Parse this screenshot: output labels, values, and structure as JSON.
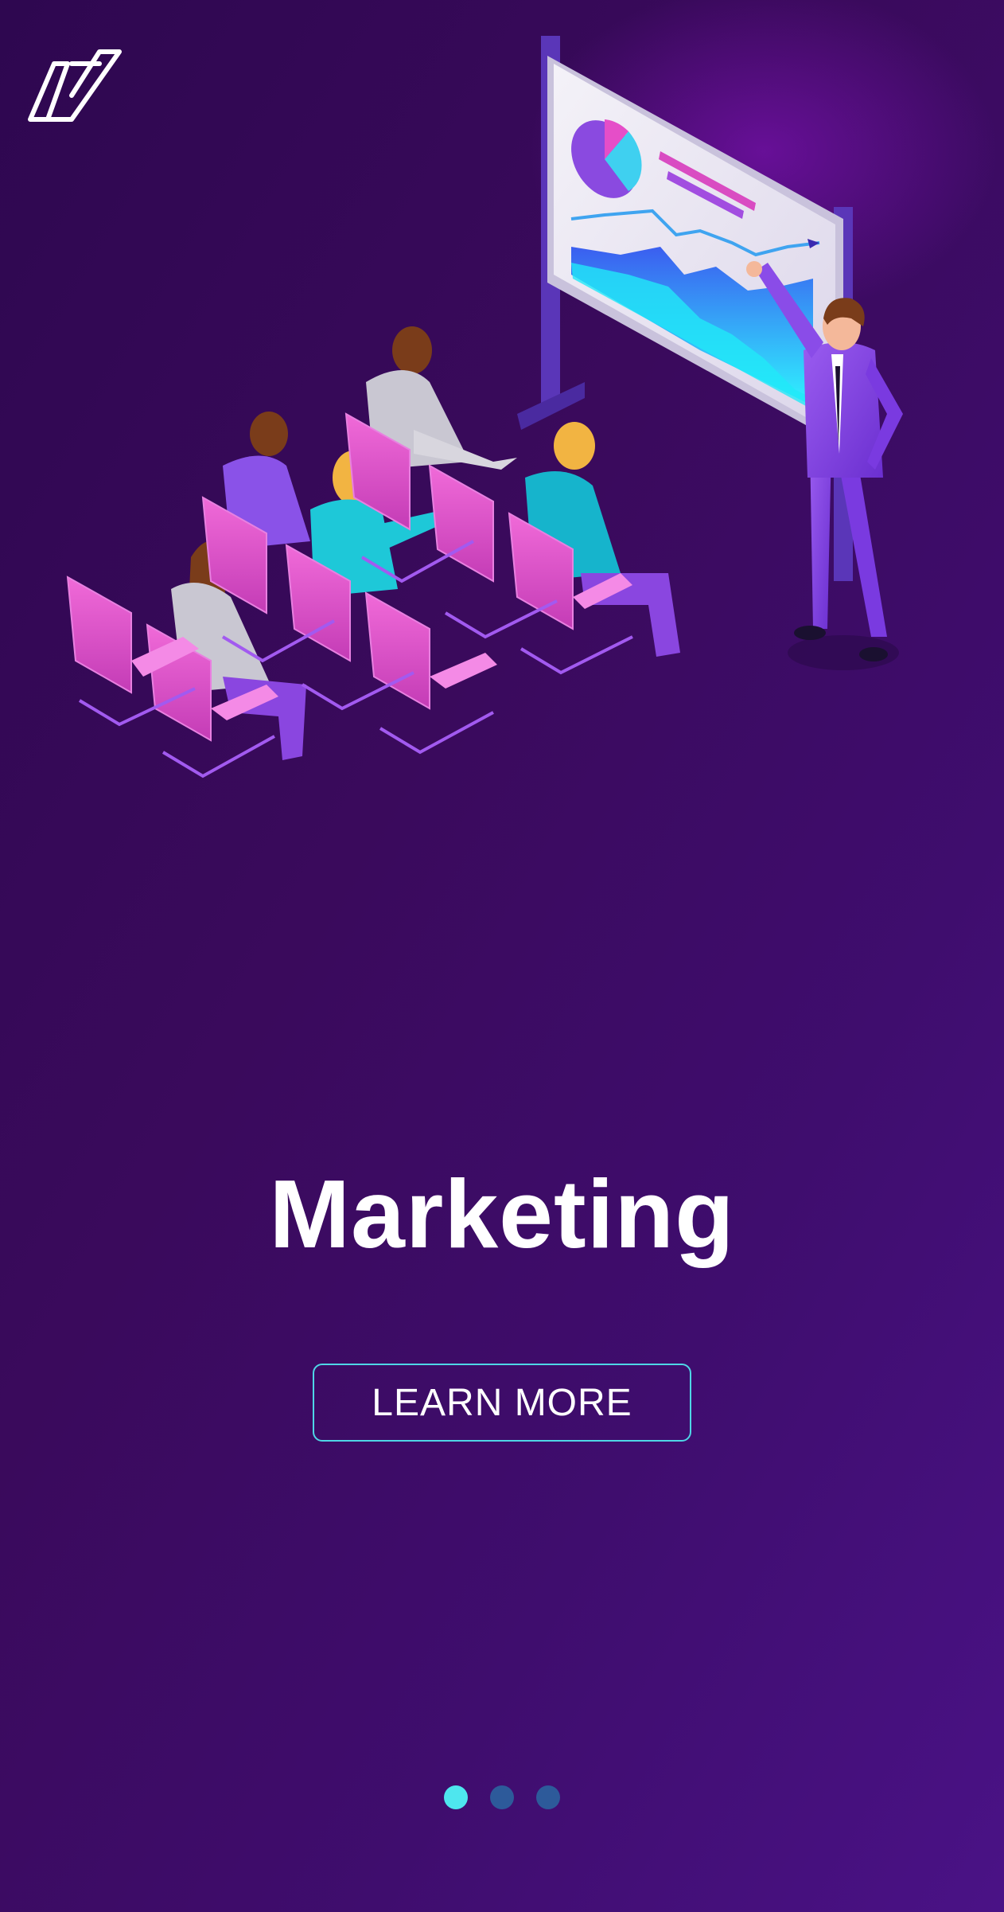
{
  "app": {
    "logo": "v-brand-logo"
  },
  "slide": {
    "title": "Marketing",
    "cta_label": "LEARN MORE",
    "illustration": "presentation-meeting-illustration"
  },
  "pagination": {
    "total": 3,
    "active_index": 0
  },
  "colors": {
    "background_start": "#2e0750",
    "background_end": "#4a1286",
    "button_border": "#4fd6e6",
    "dot_active": "#4ee6ee",
    "dot_inactive": "#2d5a9a"
  }
}
